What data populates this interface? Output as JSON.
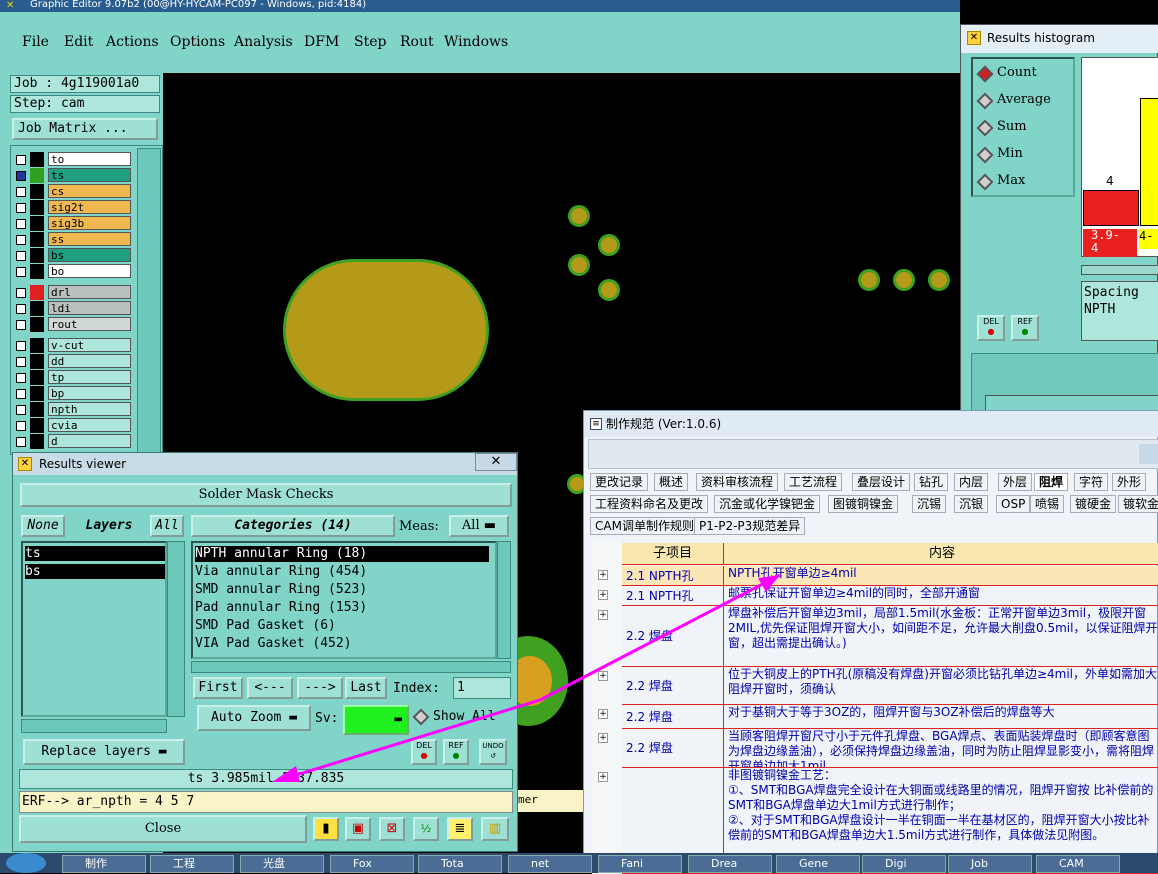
{
  "window_title": "Graphic Editor 9.07b2 (00@HY-HYCAM-PC097 - Windows, pid:4184)",
  "menu": [
    "File",
    "Edit",
    "Actions",
    "Options",
    "Analysis",
    "DFM",
    "Step",
    "Rout",
    "Windows"
  ],
  "job": "Job : 4g119001a0",
  "step": "Step: cam",
  "job_matrix": "Job Matrix ...",
  "layers": [
    {
      "name": "to",
      "color": "#ffffff",
      "sel": false
    },
    {
      "name": "ts",
      "color": "#20a080",
      "sel": true
    },
    {
      "name": "cs",
      "color": "#f0b850",
      "sel": false
    },
    {
      "name": "sig2t",
      "color": "#f0b850",
      "sel": false
    },
    {
      "name": "sig3b",
      "color": "#f0b850",
      "sel": false
    },
    {
      "name": "ss",
      "color": "#f0b850",
      "sel": false
    },
    {
      "name": "bs",
      "color": "#20a080",
      "sel": false
    },
    {
      "name": "bo",
      "color": "#ffffff",
      "sel": false
    },
    {
      "name": "drl",
      "color": "#b8c0c0",
      "sel": false
    },
    {
      "name": "ldi",
      "color": "#b8c0c0",
      "sel": false
    },
    {
      "name": "rout",
      "color": "#d0d8d8",
      "sel": false
    },
    {
      "name": "v-cut",
      "color": "#aee6dc",
      "sel": false
    },
    {
      "name": "dd",
      "color": "#aee6dc",
      "sel": false
    },
    {
      "name": "tp",
      "color": "#aee6dc",
      "sel": false
    },
    {
      "name": "bp",
      "color": "#aee6dc",
      "sel": false
    },
    {
      "name": "npth",
      "color": "#aee6dc",
      "sel": false
    },
    {
      "name": "cvia",
      "color": "#aee6dc",
      "sel": false
    },
    {
      "name": "d",
      "color": "#aee6dc",
      "sel": false
    }
  ],
  "results_viewer": {
    "title": "Results viewer",
    "header": "Solder Mask Checks",
    "none_btn": "None",
    "layers_label": "Layers",
    "all_btn": "All",
    "layer_items": [
      "ts",
      "bs"
    ],
    "categories_label": "Categories (14)",
    "meas_label": "Meas:",
    "meas_value": "All",
    "categories": [
      "NPTH annular Ring (18)",
      "Via annular Ring (454)",
      "SMD annular Ring (523)",
      "Pad annular Ring (153)",
      "SMD Pad Gasket (6)",
      "VIA Pad Gasket (452)"
    ],
    "first_btn": "First",
    "prev_btn": "<---",
    "next_btn": "--->",
    "last_btn": "Last",
    "index_label": "Index:",
    "index_value": "1",
    "auto_zoom": "Auto Zoom",
    "sv_label": "Sv:",
    "show_all": "Show All",
    "replace_layers": "Replace layers",
    "del_btn": "DEL",
    "ref_btn": "REF",
    "undo_btn": "UNDO",
    "status": "ts 3.985mil 1137.835",
    "erf": "ERF--> ar_npth = 4 5 7",
    "close_btn": "Close",
    "partial_text": "mer"
  },
  "histogram": {
    "title": "Results histogram",
    "options": [
      "Count",
      "Average",
      "Sum",
      "Min",
      "Max"
    ],
    "selected": "Count",
    "bar_label": "4",
    "range_label": "3.9-\n4",
    "range_label2": "4-",
    "spacing": "Spacing",
    "npth": "NPTH",
    "del_btn": "DEL",
    "ref_btn": "REF"
  },
  "spec": {
    "title": "制作规范 (Ver:1.0.6)",
    "tabs_row1": [
      "更改记录",
      "概述",
      "资料审核流程",
      "工艺流程",
      "叠层设计",
      "钻孔",
      "内层",
      "外层",
      "阻焊",
      "字符",
      "外形"
    ],
    "tabs_row2": [
      "工程资料命名及更改",
      "沉金或化学镍钯金",
      "图镀铜镍金",
      "沉锡",
      "沉银",
      "OSP",
      "喷锡",
      "镀硬金",
      "镀软金"
    ],
    "tabs_row3": [
      "CAM调单制作规则",
      "P1-P2-P3规范差异"
    ],
    "active_tab": "阻焊",
    "col_item": "子项目",
    "col_content": "内容",
    "rows": [
      {
        "item": "2.1 NPTH孔",
        "content": "NPTH孔开窗单边≥4mil"
      },
      {
        "item": "2.1 NPTH孔",
        "content": "邮票孔保证开窗单边≥4mil的同时，全部开通窗"
      },
      {
        "item": "2.2 焊盘",
        "content": "焊盘补偿后开窗单边3mil，局部1.5mil(水金板：正常开窗单边3mil，极限开窗2MIL,优先保证阻焊开窗大小，如间距不足，允许最大削盘0.5mil，以保证阻焊开窗，超出需提出确认。)"
      },
      {
        "item": "2.2 焊盘",
        "content": "位于大铜皮上的PTH孔(原稿没有焊盘)开窗必须比钻孔单边≥4mil，外单如需加大阻焊开窗时，须确认"
      },
      {
        "item": "2.2 焊盘",
        "content": "对于基铜大于等于3OZ的，阻焊开窗与3OZ补偿后的焊盘等大"
      },
      {
        "item": "2.2 焊盘",
        "content": "当顾客阻焊开窗尺寸小于元件孔焊盘、BGA焊点、表面贴装焊盘时（即顾客意图为焊盘边缘盖油），必须保持焊盘边缘盖油，同时为防止阻焊显影变小，需将阻焊开窗单边加大1mil"
      },
      {
        "item": "",
        "content": "非图镀铜镍金工艺：\n①、SMT和BGA焊盘完全设计在大铜面或线路里的情况，阻焊开窗按 比补偿前的SMT和BGA焊盘单边大1mil方式进行制作；\n②、对于SMT和BGA焊盘设计一半在铜面一半在基材区的，阻焊开窗大小按比补偿前的SMT和BGA焊盘单边大1.5mil方式进行制作，具体做法见附图。"
      }
    ]
  },
  "taskbar": [
    "制作",
    "工程",
    "光盘",
    "Fox",
    "Tota",
    "net",
    "Fani",
    "Drea",
    "Gene",
    "Digi",
    "Job",
    "CAM"
  ],
  "colors": {
    "pad_fill": "#b59a1a",
    "pad_edge": "#40a020",
    "arrow": "#ff00ff",
    "panel": "#80d4c8"
  }
}
